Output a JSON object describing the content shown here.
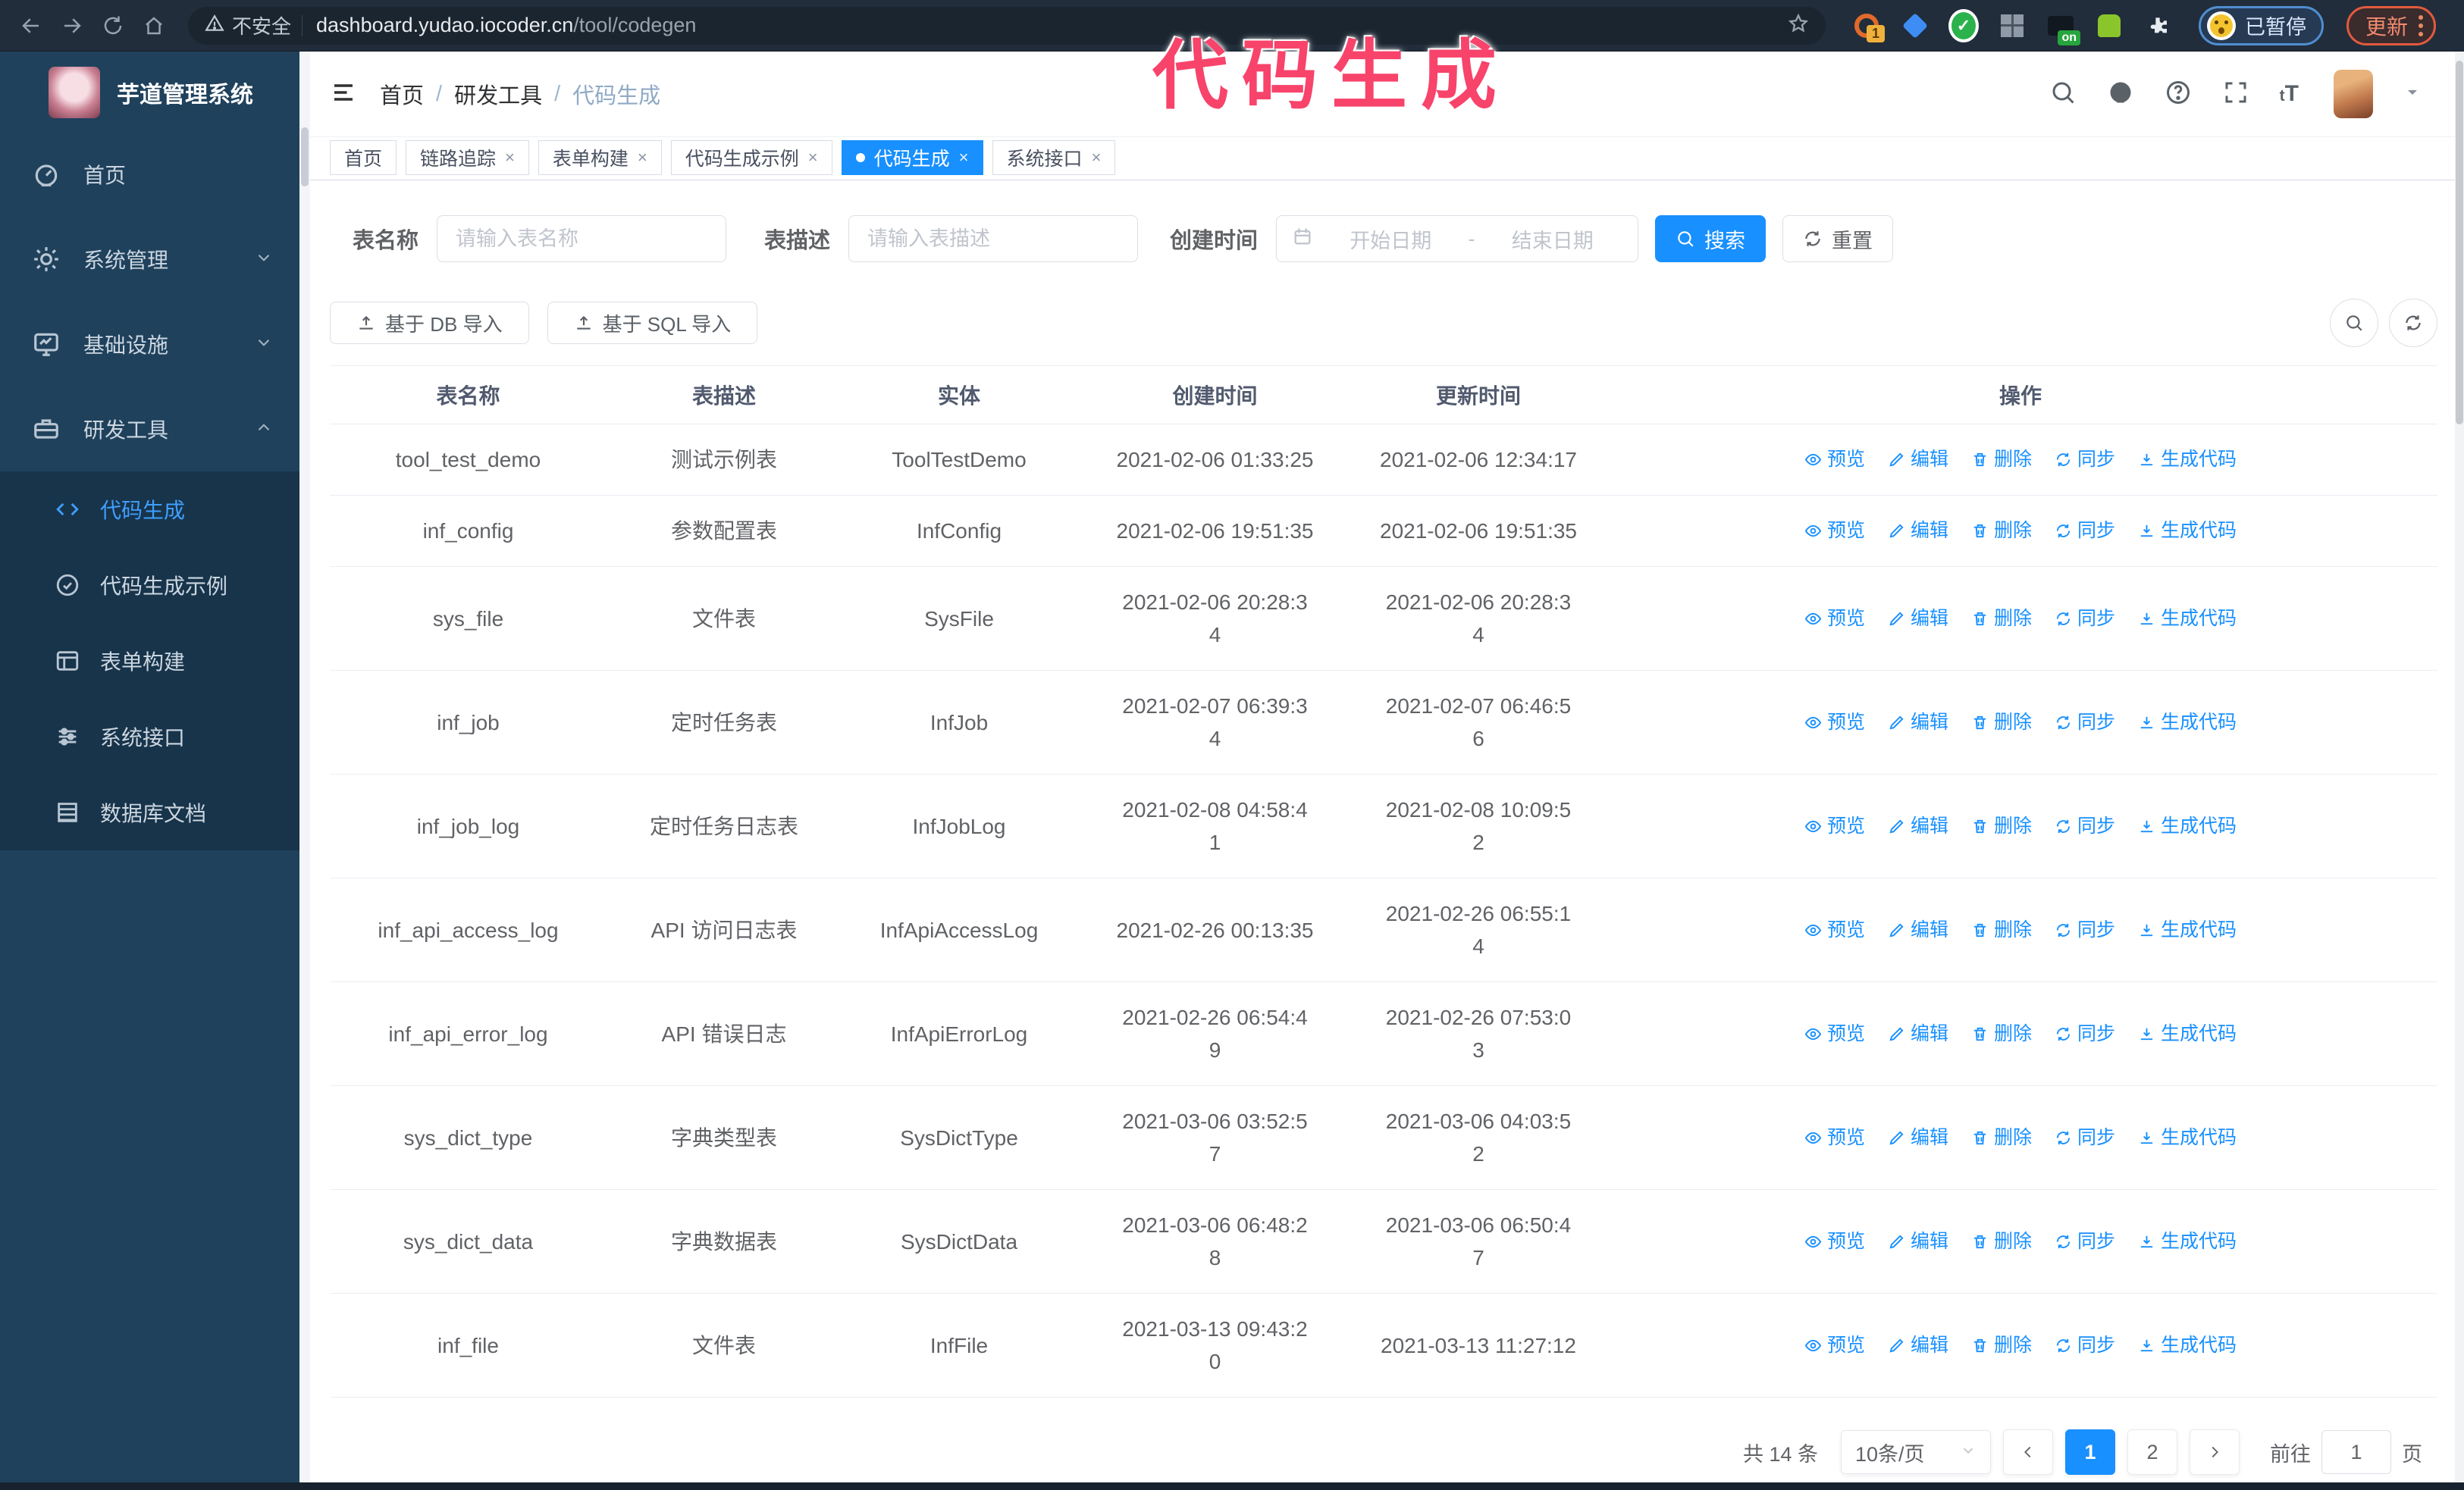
{
  "colors": {
    "accent": "#1890ff",
    "annotation": "#f8436b",
    "sidebar_bg": "#1f415c",
    "chrome_bg": "#212d3b"
  },
  "annotation": {
    "text": "代码生成"
  },
  "browser": {
    "security_label": "不安全",
    "url_host": "dashboard.yudao.iocoder.cn",
    "url_path": "/tool/codegen",
    "extension_badge": "1",
    "extension_on_badge": "on",
    "paused_badge": "已暂停",
    "update_button": "更新"
  },
  "sidebar": {
    "title": "芋道管理系统",
    "items": [
      {
        "label": "首页",
        "icon": "dashboard-icon",
        "chevron": null
      },
      {
        "label": "系统管理",
        "icon": "gear-icon",
        "chevron": "down"
      },
      {
        "label": "基础设施",
        "icon": "monitor-icon",
        "chevron": "down"
      },
      {
        "label": "研发工具",
        "icon": "toolbox-icon",
        "chevron": "up",
        "children": [
          {
            "label": "代码生成",
            "icon": "code-icon",
            "active": true
          },
          {
            "label": "代码生成示例",
            "icon": "example-icon",
            "active": false
          },
          {
            "label": "表单构建",
            "icon": "form-icon",
            "active": false
          },
          {
            "label": "系统接口",
            "icon": "api-icon",
            "active": false
          },
          {
            "label": "数据库文档",
            "icon": "database-icon",
            "active": false
          }
        ]
      }
    ]
  },
  "header": {
    "breadcrumb": [
      "首页",
      "研发工具",
      "代码生成"
    ]
  },
  "tabs": [
    {
      "label": "首页",
      "closable": false,
      "active": false
    },
    {
      "label": "链路追踪",
      "closable": true,
      "active": false
    },
    {
      "label": "表单构建",
      "closable": true,
      "active": false
    },
    {
      "label": "代码生成示例",
      "closable": true,
      "active": false
    },
    {
      "label": "代码生成",
      "closable": true,
      "active": true
    },
    {
      "label": "系统接口",
      "closable": true,
      "active": false
    }
  ],
  "filters": {
    "table_name_label": "表名称",
    "table_name_placeholder": "请输入表名称",
    "table_desc_label": "表描述",
    "table_desc_placeholder": "请输入表描述",
    "create_time_label": "创建时间",
    "date_start_placeholder": "开始日期",
    "date_separator": "-",
    "date_end_placeholder": "结束日期",
    "search_button": "搜索",
    "reset_button": "重置"
  },
  "toolbar": {
    "import_db_button": "基于 DB 导入",
    "import_sql_button": "基于 SQL 导入"
  },
  "table": {
    "columns": [
      "表名称",
      "表描述",
      "实体",
      "创建时间",
      "更新时间",
      "操作"
    ],
    "actions": [
      {
        "label": "预览",
        "icon": "eye-icon"
      },
      {
        "label": "编辑",
        "icon": "edit-icon"
      },
      {
        "label": "删除",
        "icon": "delete-icon"
      },
      {
        "label": "同步",
        "icon": "sync-icon"
      },
      {
        "label": "生成代码",
        "icon": "download-icon"
      }
    ],
    "rows": [
      {
        "name": "tool_test_demo",
        "desc": "测试示例表",
        "entity": "ToolTestDemo",
        "created": "2021-02-06 01:33:25",
        "updated": "2021-02-06 12:34:17"
      },
      {
        "name": "inf_config",
        "desc": "参数配置表",
        "entity": "InfConfig",
        "created": "2021-02-06 19:51:35",
        "updated": "2021-02-06 19:51:35"
      },
      {
        "name": "sys_file",
        "desc": "文件表",
        "entity": "SysFile",
        "created": "2021-02-06 20:28:3\n4",
        "updated": "2021-02-06 20:28:3\n4"
      },
      {
        "name": "inf_job",
        "desc": "定时任务表",
        "entity": "InfJob",
        "created": "2021-02-07 06:39:3\n4",
        "updated": "2021-02-07 06:46:5\n6"
      },
      {
        "name": "inf_job_log",
        "desc": "定时任务日志表",
        "entity": "InfJobLog",
        "created": "2021-02-08 04:58:4\n1",
        "updated": "2021-02-08 10:09:5\n2"
      },
      {
        "name": "inf_api_access_log",
        "desc": "API 访问日志表",
        "entity": "InfApiAccessLog",
        "created": "2021-02-26 00:13:35",
        "updated": "2021-02-26 06:55:1\n4"
      },
      {
        "name": "inf_api_error_log",
        "desc": "API 错误日志",
        "entity": "InfApiErrorLog",
        "created": "2021-02-26 06:54:4\n9",
        "updated": "2021-02-26 07:53:0\n3"
      },
      {
        "name": "sys_dict_type",
        "desc": "字典类型表",
        "entity": "SysDictType",
        "created": "2021-03-06 03:52:5\n7",
        "updated": "2021-03-06 04:03:5\n2"
      },
      {
        "name": "sys_dict_data",
        "desc": "字典数据表",
        "entity": "SysDictData",
        "created": "2021-03-06 06:48:2\n8",
        "updated": "2021-03-06 06:50:4\n7"
      },
      {
        "name": "inf_file",
        "desc": "文件表",
        "entity": "InfFile",
        "created": "2021-03-13 09:43:2\n0",
        "updated": "2021-03-13 11:27:12"
      }
    ]
  },
  "pagination": {
    "total_text": "共 14 条",
    "page_size": "10条/页",
    "pages": [
      "1",
      "2"
    ],
    "active_page": "1",
    "goto_label": "前往",
    "goto_value": "1",
    "goto_suffix": "页"
  }
}
